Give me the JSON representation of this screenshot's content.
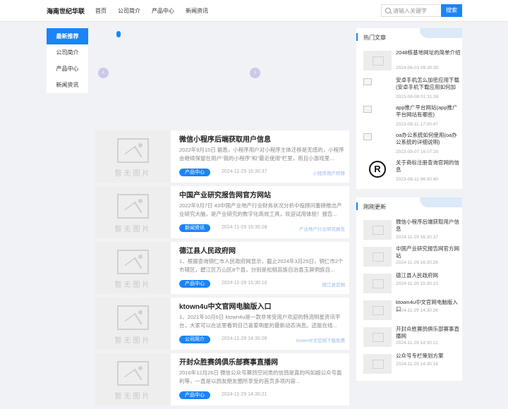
{
  "header": {
    "logo": "海南世纪华联",
    "nav": [
      "首页",
      "公司简介",
      "产品中心",
      "新闻资讯"
    ],
    "search_placeholder": "请输入关键字",
    "search_button": "搜索"
  },
  "sidebar": {
    "items": [
      {
        "label": "最新推荐",
        "active": true
      },
      {
        "label": "公司简介",
        "active": false
      },
      {
        "label": "产品中心",
        "active": false
      },
      {
        "label": "新闻资讯",
        "active": false
      }
    ]
  },
  "banner": {
    "prev_icon": "chevron-left-icon",
    "next_icon": "chevron-right-icon",
    "prev_glyph": "‹",
    "next_glyph": "›"
  },
  "placeholder_text": "暂无图片",
  "articles": [
    {
      "title": "微信小程序后端获取用户信息",
      "desc": "2022年9月15日  据悉，小程序用户对小程序主体迁移是无感的，小程序会继续保留在用户\"我的小程序\"和\"最近使用\"栏里，而且小游戏里...",
      "tag": "产品中心",
      "date": "2024-11-29 16:30:37",
      "source": "小程序用户转移"
    },
    {
      "title": "中国产业研究报告网官方网站",
      "desc": "2022年9月7日  43中国产业地产行业财务状况分析中投顾问重磅推出产业研究大脑，是产业研究的数字化高效工具，欢迎试用体验！报告...",
      "tag": "新闻资讯",
      "date": "2024-11-29 16:30:28",
      "source": "产业地产行业研究报告"
    },
    {
      "title": "德江县人民政府网",
      "desc": "1、根据查询铜仁市人民政府网显示，截止2024年3月25日，铜仁市2个市辖区，碧江区万山区8个县，分别是松桃苗族自治县玉屏侗族自...",
      "tag": "产品中心",
      "date": "2024-11-29 15:30:10",
      "source": "德江县官网"
    },
    {
      "title": "ktown4u中文官网电脑版入口",
      "desc": "1、2021年10月6日  ktown4u是一款非常受用户欢迎的韩流明星资讯平台，大家可以在这里看到自己喜爱明星的最新动态消息。还能在线...",
      "tag": "公司简介",
      "date": "2024-11-29 14:30:26",
      "source": "ktown中文官网下载免费"
    },
    {
      "title": "开封众胜赛鸽俱乐部赛事直播网",
      "desc": "2016年12月26日  微信公众号赛鸽空间类的信鸽是真的吗如超公众号盈利等，一直是以鸽友朋友圈所享受的首页多项内容...",
      "tag": "产品中心",
      "date": "2024-11-29 14:30:21",
      "source": ""
    }
  ],
  "hot": {
    "title": "热门文章",
    "items": [
      {
        "title": "2048核基地网址的简单介绍",
        "date": "2024-06-03 09:30:30",
        "img": "thumb"
      },
      {
        "title": "安卓手机怎么加密应用下载(安卓手机下载应用如何加密)",
        "date": "2023-08-08 01:31:39",
        "img": "broken"
      },
      {
        "title": "app推广平台网站(app推广平台网站有哪些)",
        "date": "2023-08-11 17:00:47",
        "img": "broken"
      },
      {
        "title": "oa办公系统如何使用(oa办公系统的详细说明)",
        "date": "2023-08-07 16:07:20",
        "img": "broken"
      },
      {
        "title": "关于商标注册查询官网的信息",
        "date": "2023-08-11 06:00:40",
        "img": "registered",
        "glyph": "R"
      }
    ]
  },
  "recent": {
    "title": "刚刚更新",
    "items": [
      {
        "title": "微信小程序后端获取用户信息",
        "date": "2024-11-29 16:30:37"
      },
      {
        "title": "中国产业研究报告网官方网站",
        "date": "2024-11-29 16:30:28"
      },
      {
        "title": "德江县人民政府网",
        "date": "2024-11-29 15:30:10"
      },
      {
        "title": "ktown4u中文官网电脑版入口",
        "date": "2024-11-29 14:30:26"
      },
      {
        "title": "开封众胜赛鸽俱乐部赛事直播网",
        "date": "2024-11-29 14:30:21"
      },
      {
        "title": "公众号专栏策划方案",
        "date": "2024-11-29 14:30:18"
      }
    ]
  }
}
